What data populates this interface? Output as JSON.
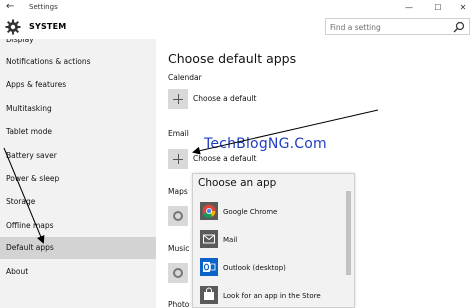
{
  "window": {
    "title": "Settings",
    "controls": [
      "minimize-icon",
      "maximize-icon",
      "close-icon"
    ]
  },
  "header": {
    "section": "SYSTEM",
    "search_placeholder": "Find a setting"
  },
  "sidebar": {
    "items": [
      {
        "label": "Display"
      },
      {
        "label": "Notifications & actions"
      },
      {
        "label": "Apps & features"
      },
      {
        "label": "Multitasking"
      },
      {
        "label": "Tablet mode"
      },
      {
        "label": "Battery saver"
      },
      {
        "label": "Power & sleep"
      },
      {
        "label": "Storage"
      },
      {
        "label": "Offline maps"
      },
      {
        "label": "Default apps",
        "selected": true
      },
      {
        "label": "About"
      }
    ]
  },
  "main": {
    "heading": "Choose default apps",
    "calendar": {
      "label": "Calendar",
      "value": "Choose a default"
    },
    "email": {
      "label": "Email",
      "value": "Choose a default"
    },
    "maps": {
      "label": "Maps"
    },
    "music": {
      "label": "Music"
    },
    "photos": {
      "label": "Photo"
    }
  },
  "watermark": "TechBlogNG.Com",
  "popup": {
    "title": "Choose an app",
    "options": [
      {
        "label": "Google Chrome",
        "icon": "chrome-icon"
      },
      {
        "label": "Mail",
        "icon": "mail-icon"
      },
      {
        "label": "Outlook (desktop)",
        "icon": "outlook-icon"
      },
      {
        "label": "Look for an app in the Store",
        "icon": "store-icon"
      }
    ]
  },
  "colors": {
    "sidebar_bg": "#f2f2f2",
    "selected_bg": "#d3d3d3",
    "tile_bg": "#d9d9d9",
    "watermark": "#1f3fbf",
    "outlook_blue": "#0a64c8"
  }
}
